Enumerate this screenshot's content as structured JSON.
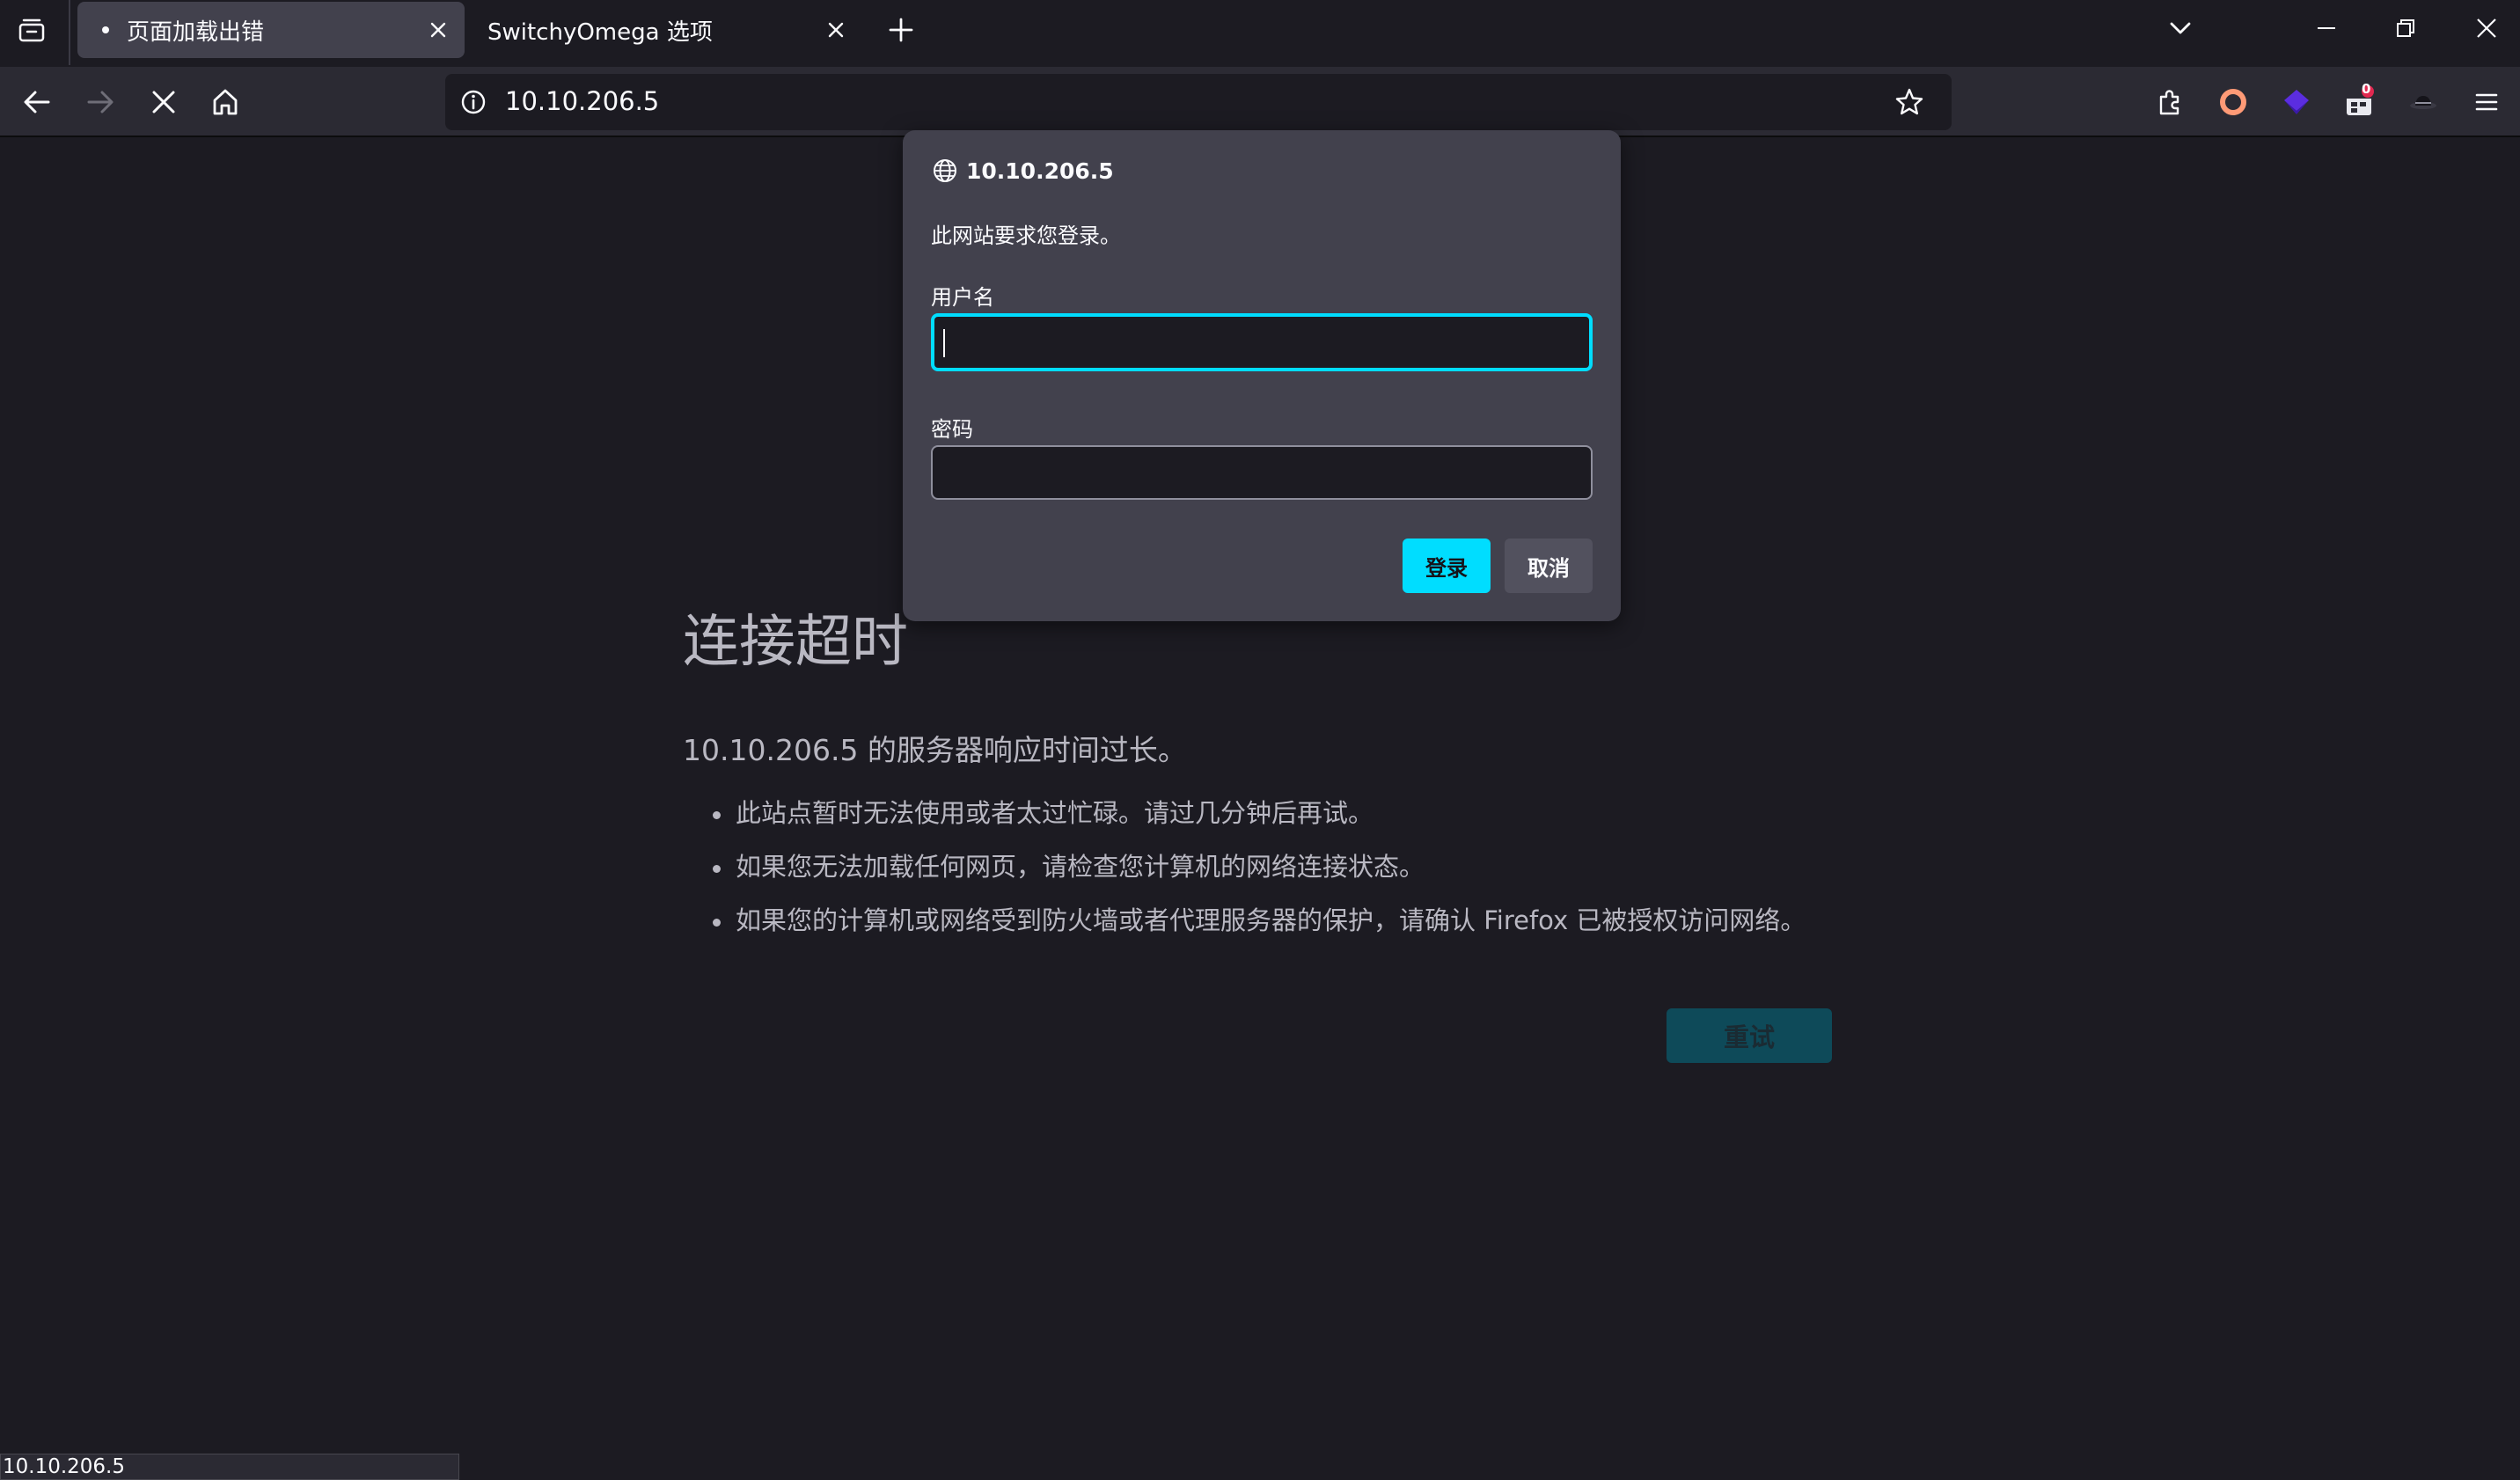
{
  "tabs": [
    {
      "label": "页面加载出错",
      "active": true
    },
    {
      "label": "SwitchyOmega 选项",
      "active": false
    }
  ],
  "navbar": {
    "url": "10.10.206.5",
    "badge_count": "0"
  },
  "icons": {
    "tab_list": "tab-list-icon",
    "back": "arrow-left-icon",
    "forward": "arrow-right-icon",
    "stop": "close-icon",
    "home": "home-icon",
    "site_info": "info-icon",
    "bookmark": "star-icon",
    "extensions": "puzzle-icon",
    "menu": "hamburger-icon"
  },
  "dialog": {
    "host": "10.10.206.5",
    "message": "此网站要求您登录。",
    "username_label": "用户名",
    "username_value": "",
    "password_label": "密码",
    "password_value": "",
    "login_label": "登录",
    "cancel_label": "取消"
  },
  "error_page": {
    "title": "连接超时",
    "subtitle": "10.10.206.5 的服务器响应时间过长。",
    "items": [
      "此站点暂时无法使用或者太过忙碌。请过几分钟后再试。",
      "如果您无法加载任何网页，请检查您计算机的网络连接状态。",
      "如果您的计算机或网络受到防火墙或者代理服务器的保护，请确认 Firefox 已被授权访问网络。"
    ],
    "retry_label": "重试"
  },
  "status_bar": {
    "text": "10.10.206.5"
  },
  "colors": {
    "accent": "#00ddff",
    "background": "#1c1b22",
    "toolbar": "#2b2a33",
    "dialog": "#42414d"
  }
}
